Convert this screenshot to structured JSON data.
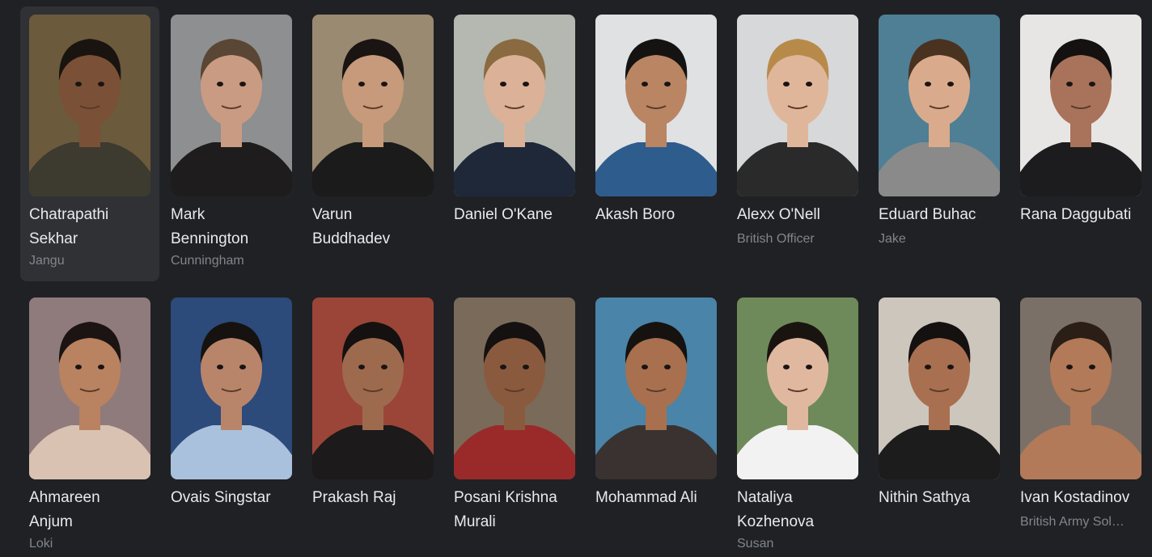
{
  "cast": [
    {
      "name_line1": "Chatrapathi",
      "name_line2": "Sekhar",
      "role": "Jangu",
      "bg": "#6b5a3c",
      "skin": "#7a5136",
      "hair": "#1a1410",
      "shirt": "#3d3a30"
    },
    {
      "name_line1": "Mark",
      "name_line2": "Bennington",
      "role": "Cunningham",
      "bg": "#8d8f91",
      "skin": "#c99b82",
      "hair": "#5a4634",
      "shirt": "#1e1c1c"
    },
    {
      "name_line1": "Varun",
      "name_line2": "Buddhadev",
      "role": "",
      "bg": "#9a8a72",
      "skin": "#c69a7a",
      "hair": "#1a1412",
      "shirt": "#1b1b1b"
    },
    {
      "name_line1": "Daniel O'Kane",
      "name_line2": "",
      "role": "",
      "bg": "#b4b8b0",
      "skin": "#dbb198",
      "hair": "#8a6a40",
      "shirt": "#1e2838"
    },
    {
      "name_line1": "Akash Boro",
      "name_line2": "",
      "role": "",
      "bg": "#dfe1e3",
      "skin": "#b98563",
      "hair": "#151312",
      "shirt": "#2e5c8c"
    },
    {
      "name_line1": "Alexx O'Nell",
      "name_line2": "",
      "role": "British Officer",
      "bg": "#d6d8da",
      "skin": "#e0b69b",
      "hair": "#b88a4a",
      "shirt": "#2a2a2a"
    },
    {
      "name_line1": "Eduard Buhac",
      "name_line2": "",
      "role": "Jake",
      "bg": "#4e7f95",
      "skin": "#d9ab8c",
      "hair": "#4a3220",
      "shirt": "#8a8a8a"
    },
    {
      "name_line1": "Rana Daggubati",
      "name_line2": "",
      "role": "",
      "bg": "#e8e6e4",
      "skin": "#a8735a",
      "hair": "#141110",
      "shirt": "#1c1c1e"
    },
    {
      "name_line1": "Ahmareen",
      "name_line2": "Anjum",
      "role": "Loki",
      "bg": "#8f7b7b",
      "skin": "#b98260",
      "hair": "#1c1412",
      "shirt": "#d9c2b2"
    },
    {
      "name_line1": "Ovais Singstar",
      "name_line2": "",
      "role": "",
      "bg": "#2c4a7a",
      "skin": "#b8856a",
      "hair": "#161210",
      "shirt": "#a9c1dc"
    },
    {
      "name_line1": "Prakash Raj",
      "name_line2": "",
      "role": "",
      "bg": "#9a4538",
      "skin": "#9e6a4e",
      "hair": "#141110",
      "shirt": "#1c1a1a"
    },
    {
      "name_line1": "Posani Krishna",
      "name_line2": "Murali",
      "role": "",
      "bg": "#7a6a5a",
      "skin": "#8a5a3e",
      "hair": "#141110",
      "shirt": "#9a2a2a"
    },
    {
      "name_line1": "Mohammad Ali",
      "name_line2": "",
      "role": "",
      "bg": "#4a84a8",
      "skin": "#a8704e",
      "hair": "#161210",
      "shirt": "#3a3230"
    },
    {
      "name_line1": "Nataliya",
      "name_line2": "Kozhenova",
      "role": "Susan",
      "bg": "#6e8a5a",
      "skin": "#e0b8a0",
      "hair": "#1a1410",
      "shirt": "#f2f2f2"
    },
    {
      "name_line1": "Nithin Sathya",
      "name_line2": "",
      "role": "",
      "bg": "#cdc6bd",
      "skin": "#a87050",
      "hair": "#141110",
      "shirt": "#1c1c1c"
    },
    {
      "name_line1": "Ivan Kostadinov",
      "name_line2": "",
      "role": "British Army Sol…",
      "bg": "#7a7068",
      "skin": "#b27a58",
      "hair": "#2a1e16",
      "shirt": "#b27a58"
    }
  ]
}
